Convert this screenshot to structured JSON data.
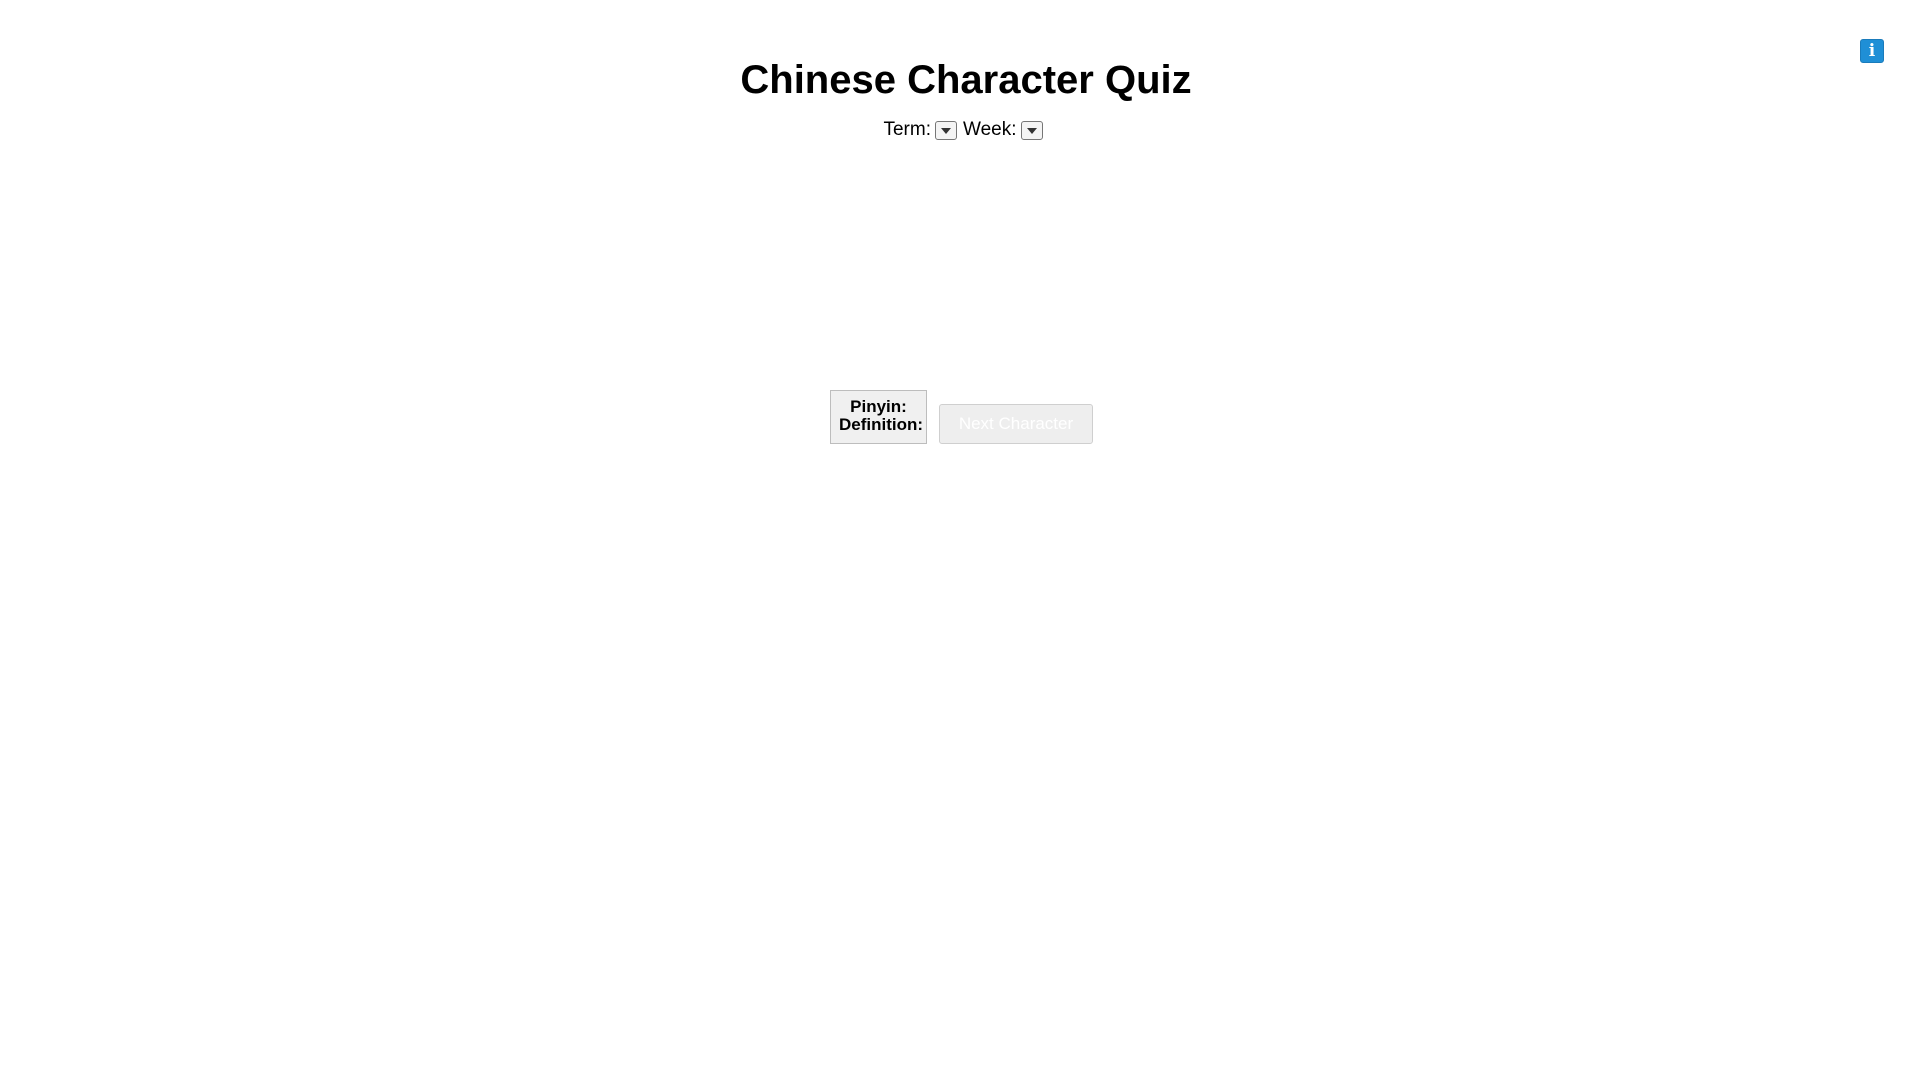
{
  "header": {
    "title": "Chinese Character Quiz",
    "info_icon": "info-icon",
    "info_glyph": "i"
  },
  "selectors": {
    "term_label": "Term:",
    "week_label": "Week:",
    "term_value": "",
    "week_value": ""
  },
  "quiz": {
    "pinyin_label": "Pinyin:",
    "definition_label": "Definition:",
    "next_button_label": "Next Character"
  },
  "colors": {
    "info_button": "#1f8fd6",
    "panel_background": "#f0f0f0",
    "disabled_button_text": "#ffffff"
  }
}
